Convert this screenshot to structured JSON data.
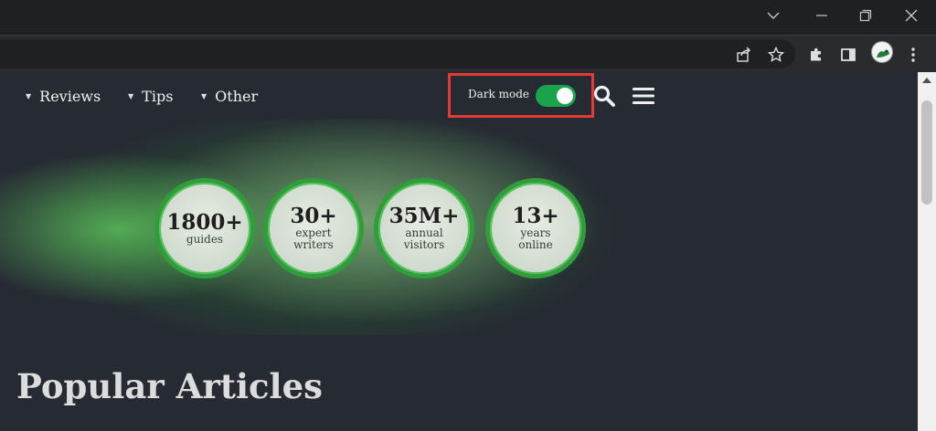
{
  "browser": {
    "window_controls": {
      "tab_search": "⌄",
      "minimize": "—",
      "restore": "❐",
      "close": "✕"
    }
  },
  "nav": {
    "items": [
      {
        "label": "Reviews"
      },
      {
        "label": "Tips"
      },
      {
        "label": "Other"
      }
    ],
    "caret": "▼",
    "dark_mode": {
      "label": "Dark mode",
      "enabled": true
    },
    "accent_color": "#1aa34a",
    "highlight_color": "#e53935"
  },
  "stats": [
    {
      "number": "1800+",
      "line1": "guides",
      "line2": ""
    },
    {
      "number": "30+",
      "line1": "expert",
      "line2": "writers"
    },
    {
      "number": "35M+",
      "line1": "annual",
      "line2": "visitors"
    },
    {
      "number": "13+",
      "line1": "years",
      "line2": "online"
    }
  ],
  "section": {
    "title": "Popular Articles"
  }
}
